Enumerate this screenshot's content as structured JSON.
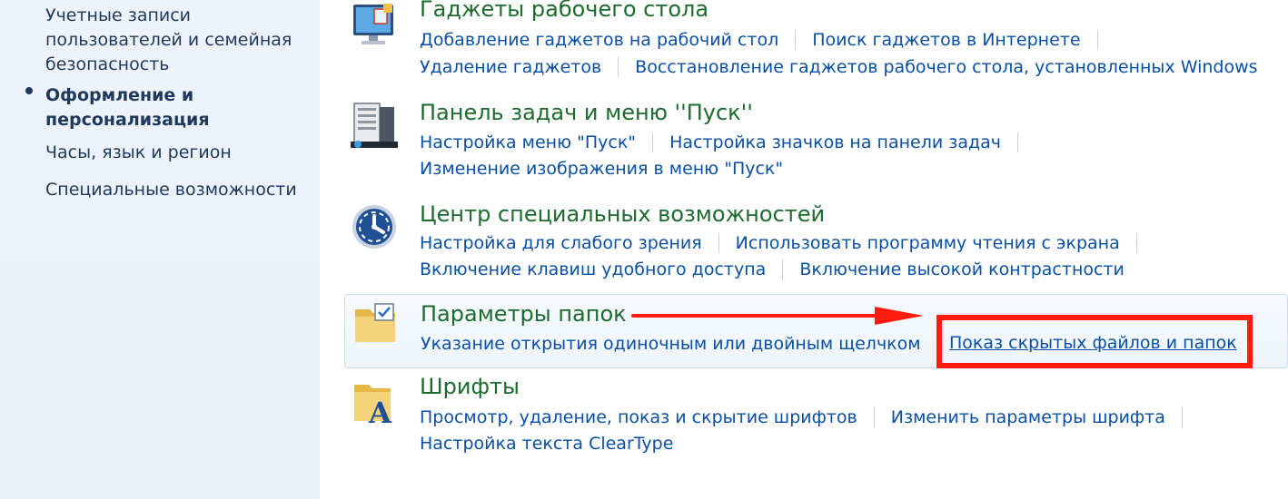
{
  "sidebar": {
    "items": [
      {
        "label_lines": [
          "Учетные записи",
          "пользователей и семейная",
          "безопасность"
        ]
      },
      {
        "label_lines": [
          "Оформление и",
          "персонализация"
        ],
        "active": true
      },
      {
        "label_lines": [
          "Часы, язык и регион"
        ]
      },
      {
        "label_lines": [
          "Специальные возможности"
        ]
      }
    ]
  },
  "sections": [
    {
      "title": "Гаджеты рабочего стола",
      "icon": "desktop-gadgets-icon",
      "links": [
        [
          "Добавление гаджетов на рабочий стол",
          "Поиск гаджетов в Интернете"
        ],
        [
          "Удаление гаджетов",
          "Восстановление гаджетов рабочего стола, установленных Windows"
        ]
      ]
    },
    {
      "title": "Панель задач и меню ''Пуск''",
      "icon": "taskbar-start-menu-icon",
      "links": [
        [
          "Настройка меню \"Пуск\"",
          "Настройка значков на панели задач"
        ],
        [
          "Изменение изображения в меню \"Пуск\""
        ]
      ]
    },
    {
      "title": "Центр специальных возможностей",
      "icon": "ease-of-access-icon",
      "links": [
        [
          "Настройка для слабого зрения",
          "Использовать программу чтения с экрана"
        ],
        [
          "Включение клавиш удобного доступа",
          "Включение высокой контрастности"
        ]
      ]
    },
    {
      "title": "Параметры папок",
      "icon": "folder-options-icon",
      "highlighted": true,
      "links": [
        [
          "Указание открытия одиночным или двойным щелчком",
          "Показ скрытых файлов и папок"
        ]
      ]
    },
    {
      "title": "Шрифты",
      "icon": "fonts-folder-icon",
      "links": [
        [
          "Просмотр, удаление, показ и скрытие шрифтов",
          "Изменить параметры шрифта"
        ],
        [
          "Настройка текста ClearType"
        ]
      ]
    }
  ],
  "annotation": {
    "color": "#ff1c0e"
  }
}
